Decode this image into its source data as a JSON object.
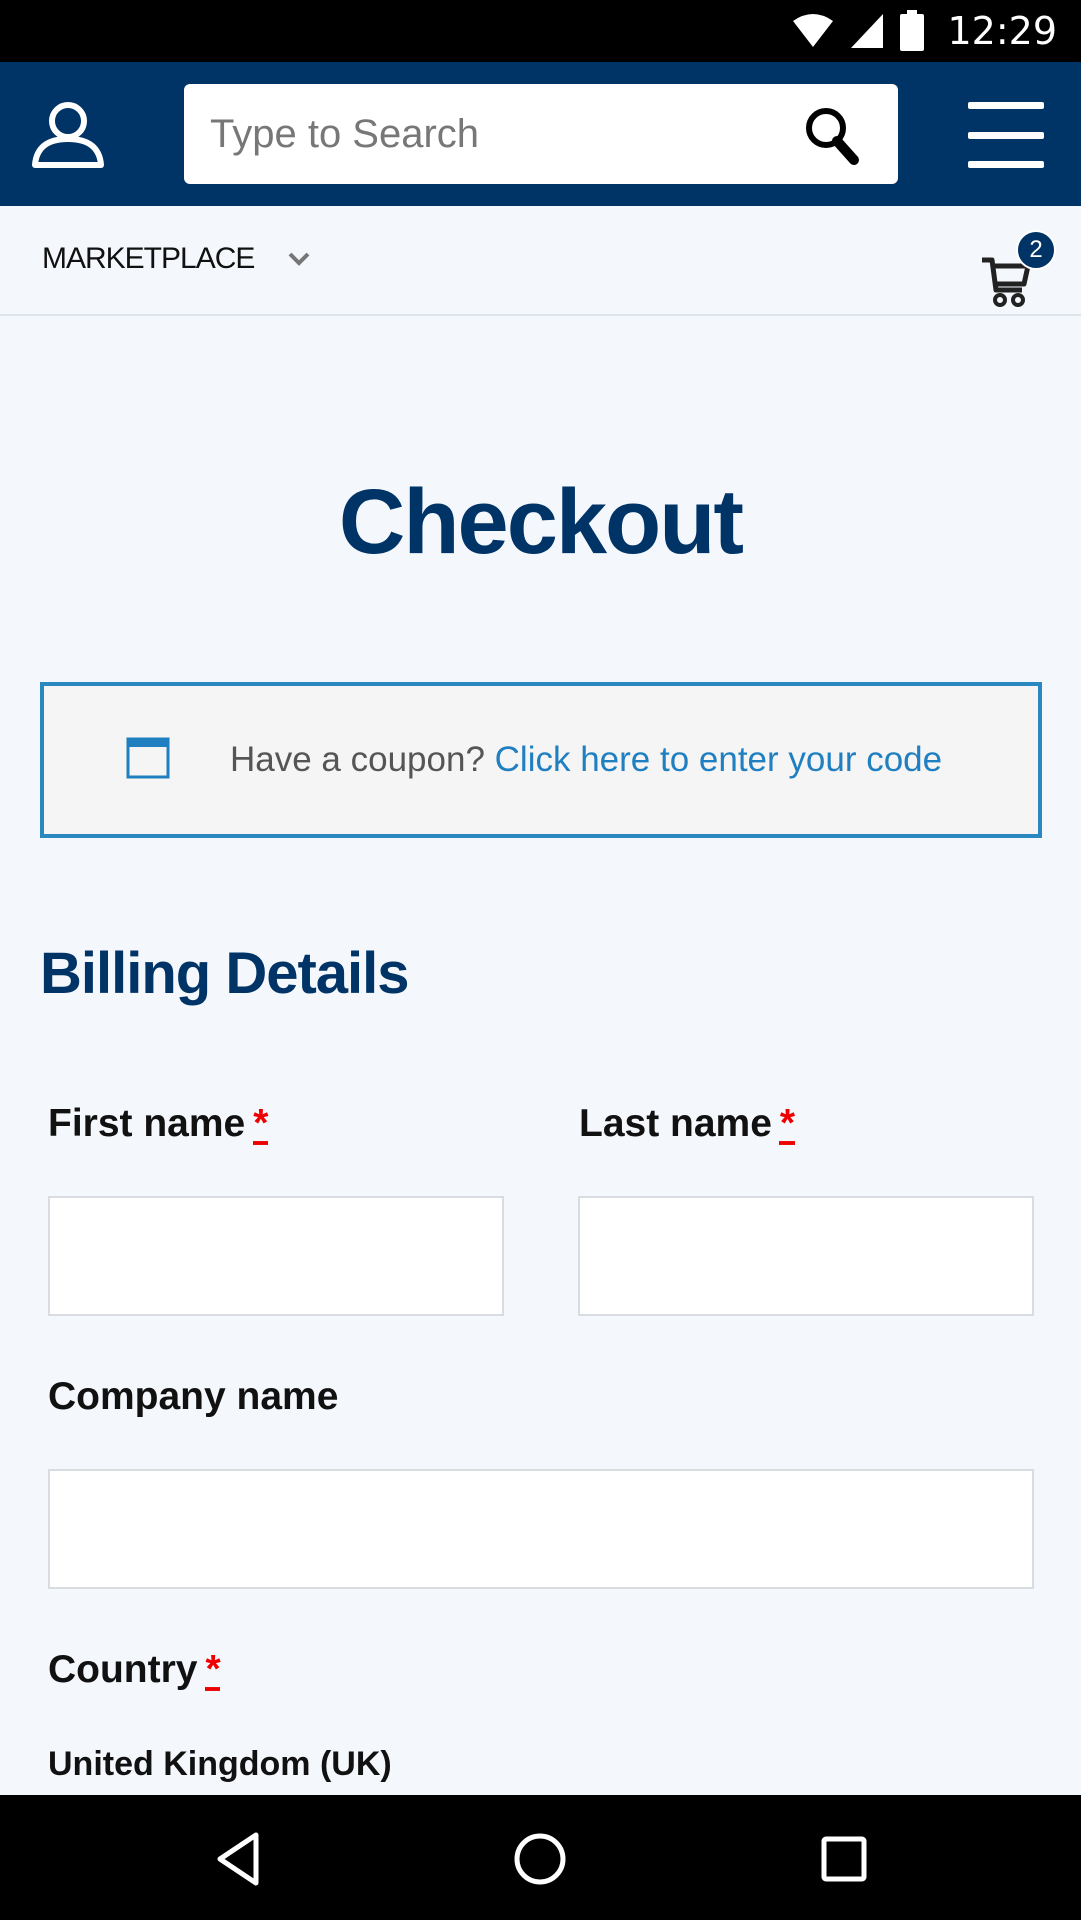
{
  "status_bar": {
    "time": "12:29",
    "icons": [
      "wifi-icon",
      "signal-icon",
      "battery-icon"
    ]
  },
  "header": {
    "search_placeholder": "Type to Search",
    "icons": [
      "user-icon",
      "search-icon",
      "menu-icon"
    ],
    "background": "#003366"
  },
  "subnav": {
    "marketplace_label": "MARKETPLACE",
    "cart_count": "2"
  },
  "main": {
    "title": "Checkout",
    "coupon": {
      "prompt": "Have a coupon?",
      "link": "Click here to enter your code"
    },
    "billing": {
      "title": "Billing Details",
      "first_name_label": "First name",
      "last_name_label": "Last name",
      "company_label": "Company name",
      "country_label": "Country",
      "required_mark": "*",
      "country_value": "United Kingdom (UK)"
    }
  },
  "colors": {
    "primary": "#003366",
    "link": "#1f7fc0",
    "required": "#e00000",
    "coupon_border": "#2a87c0"
  },
  "nav_bar": {
    "icons": [
      "back-icon",
      "home-icon",
      "recents-icon"
    ]
  }
}
